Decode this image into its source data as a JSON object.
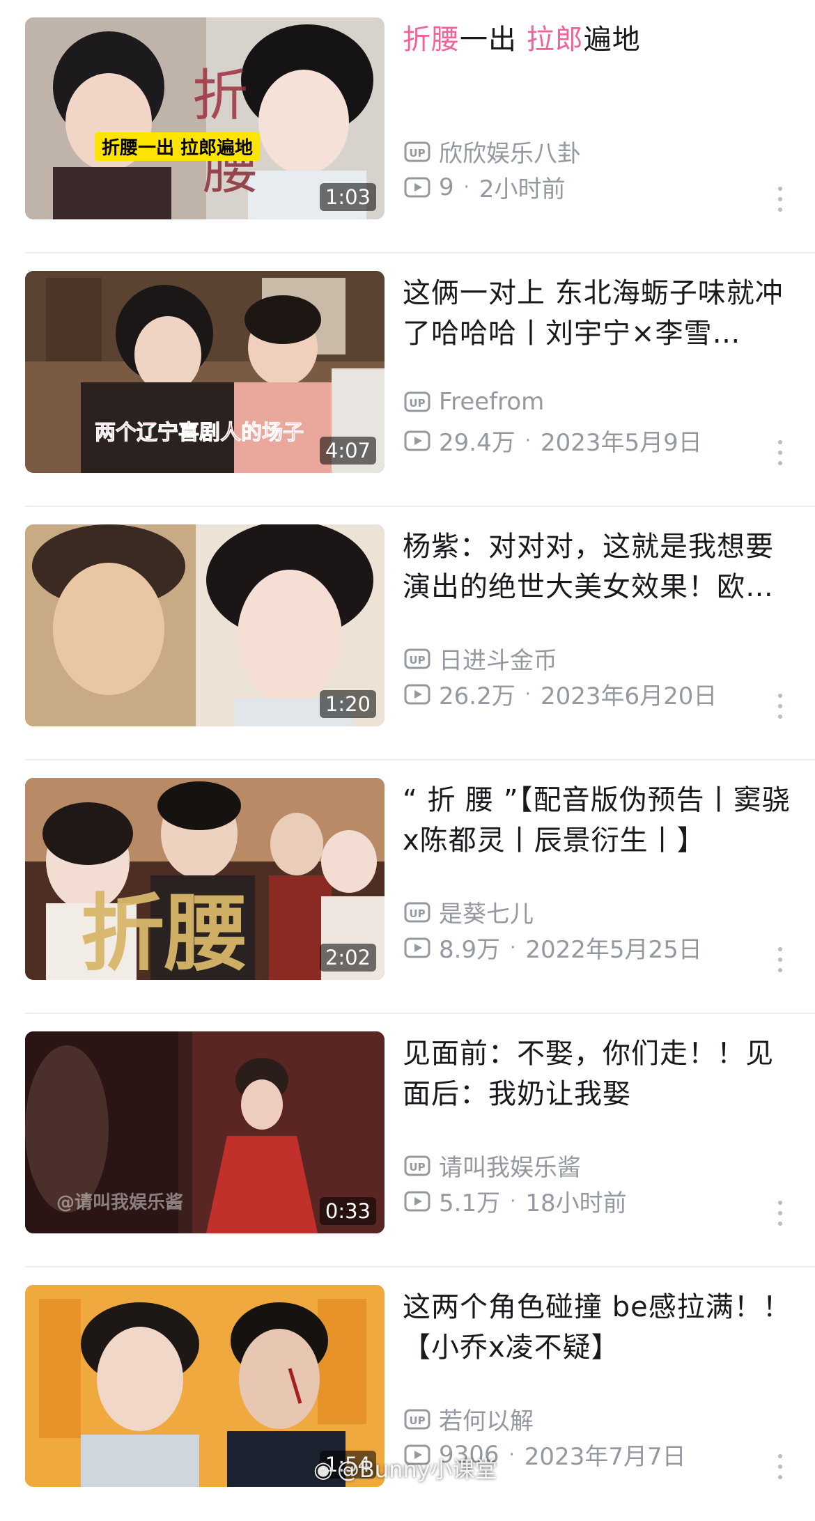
{
  "videos": [
    {
      "title_parts": [
        {
          "text": "折腰",
          "highlight": true
        },
        {
          "text": "一出 ",
          "highlight": false
        },
        {
          "text": "拉郎",
          "highlight": true
        },
        {
          "text": "遍地",
          "highlight": false
        }
      ],
      "duration": "1:03",
      "uploader": "欣欣娱乐八卦",
      "views": "9",
      "date": "2小时前",
      "overlay_text": "折腰一出 拉郎遍地",
      "art_text": "折 腰"
    },
    {
      "title": "这俩一对上 东北海蛎子味就冲了哈哈哈丨刘宇宁×李雪…",
      "duration": "4:07",
      "uploader": "Freefrom",
      "views": "29.4万",
      "date": "2023年5月9日",
      "overlay_text": "两个辽宁喜剧人的场子"
    },
    {
      "title": "杨紫：对对对，这就是我想要演出的绝世大美女效果！欧…",
      "duration": "1:20",
      "uploader": "日进斗金币",
      "views": "26.2万",
      "date": "2023年6月20日"
    },
    {
      "title": "“ 折 腰 ”【配音版伪预告丨窦骁x陈都灵丨辰景衍生丨】",
      "duration": "2:02",
      "uploader": "是葵七儿",
      "views": "8.9万",
      "date": "2022年5月25日",
      "art_text": "折腰"
    },
    {
      "title": "见面前：不娶，你们走！！见面后：我奶让我娶",
      "duration": "0:33",
      "uploader": "请叫我娱乐酱",
      "views": "5.1万",
      "date": "18小时前",
      "overlay_text": "@请叫我娱乐酱"
    },
    {
      "title": "这两个角色碰撞 be感拉满！！【小乔x凌不疑】",
      "duration": "1:54",
      "uploader": "若何以解",
      "views": "9306",
      "date": "2023年7月7日"
    }
  ],
  "watermark": "@Bunny小课堂",
  "colors": {
    "highlight": "#f0649a",
    "meta": "#9499a0",
    "title": "#18191c"
  },
  "icons": {
    "uploader": "up-badge-icon",
    "views": "play-count-icon",
    "menu": "more-vertical-icon"
  }
}
